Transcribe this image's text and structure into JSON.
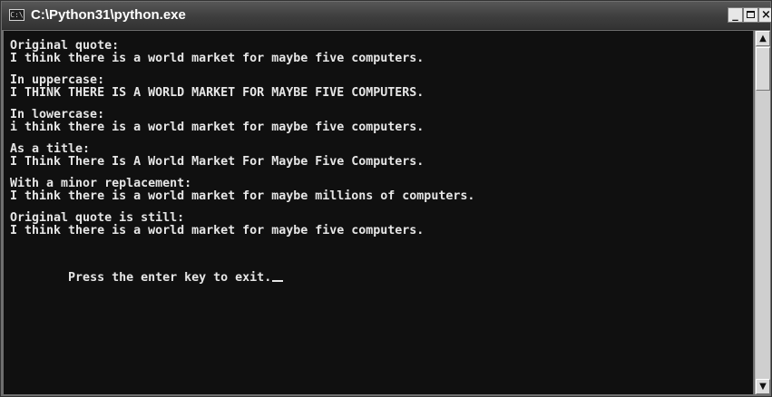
{
  "window": {
    "icon_label": "C:\\",
    "title": "C:\\Python31\\python.exe",
    "buttons": {
      "minimize": "_",
      "close": "×"
    }
  },
  "console": {
    "lines": [
      {
        "text": "Original quote:"
      },
      {
        "text": "I think there is a world market for maybe five computers."
      },
      {
        "text": "In uppercase:"
      },
      {
        "text": "I THINK THERE IS A WORLD MARKET FOR MAYBE FIVE COMPUTERS."
      },
      {
        "text": "In lowercase:"
      },
      {
        "text": "i think there is a world market for maybe five computers."
      },
      {
        "text": "As a title:"
      },
      {
        "text": "I Think There Is A World Market For Maybe Five Computers."
      },
      {
        "text": "With a minor replacement:"
      },
      {
        "text": "I think there is a world market for maybe millions of computers."
      },
      {
        "text": "Original quote is still:"
      },
      {
        "text": "I think there is a world market for maybe five computers."
      },
      {
        "text": "Press the enter key to exit."
      }
    ],
    "cursor_visible": true
  },
  "scrollbar": {
    "up_arrow": "▲",
    "down_arrow": "▼"
  },
  "colors": {
    "console_background": "#101010",
    "console_text": "#e6e6e6",
    "titlebar": "#3e3e3e",
    "scrollbar": "#cfcfcf"
  }
}
